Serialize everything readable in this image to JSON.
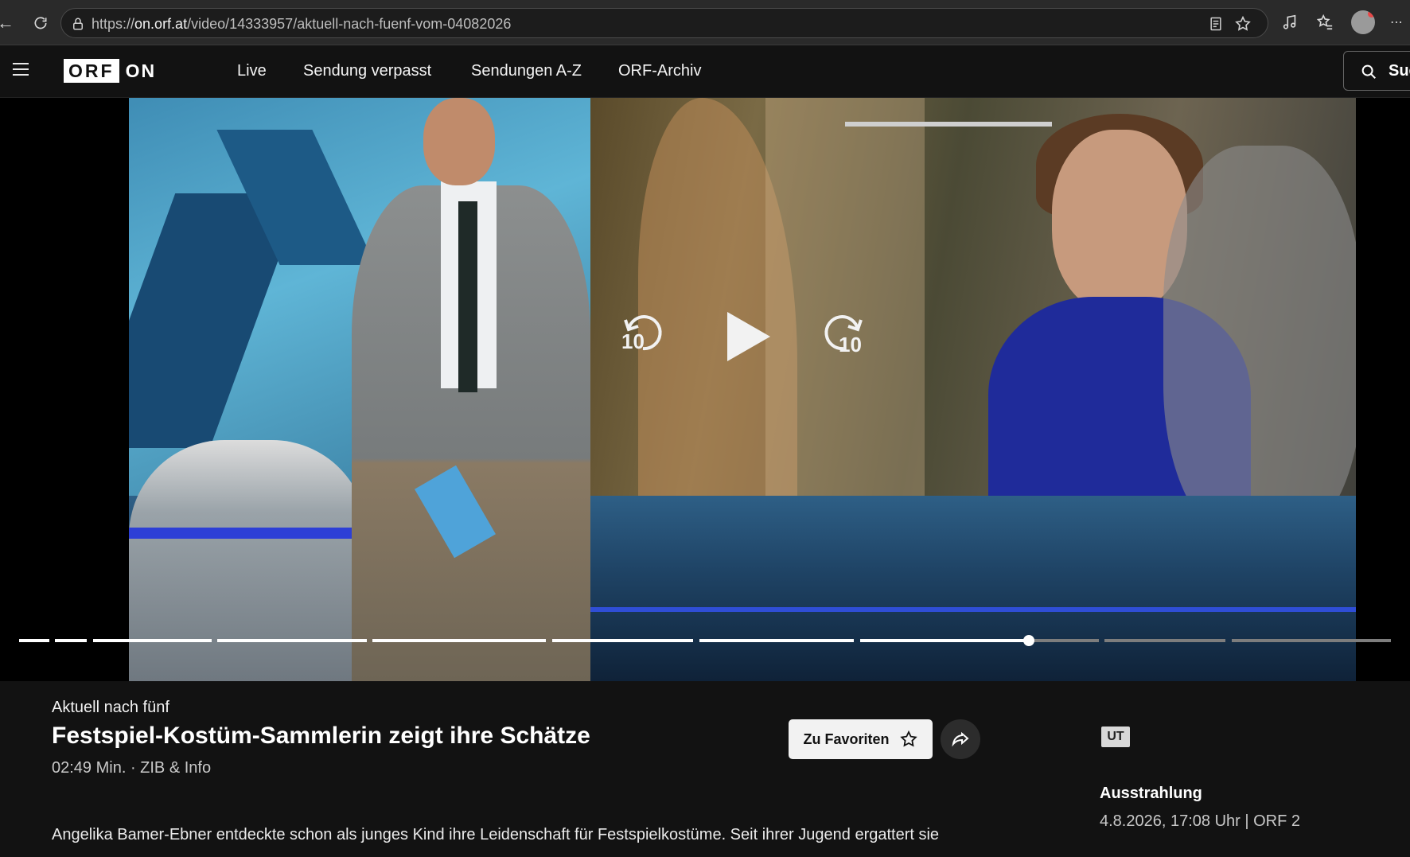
{
  "browser": {
    "url_prefix": "https://",
    "url_host": "on.orf.at",
    "url_path": "/video/14333957/aktuell-nach-fuenf-vom-04082026"
  },
  "header": {
    "logo_box": "ORF",
    "logo_suffix": "ON",
    "nav": [
      "Live",
      "Sendung verpasst",
      "Sendungen A-Z",
      "ORF-Archiv"
    ],
    "search_label": "Suc"
  },
  "player": {
    "back_seconds": "10",
    "forward_seconds": "10",
    "progress_fraction": 0.74
  },
  "info": {
    "show_name": "Aktuell nach fünf",
    "title": "Festspiel-Kostüm-Sammlerin zeigt ihre Schätze",
    "meta": "02:49 Min. · ZIB & Info",
    "favorite_label": "Zu Favoriten",
    "subtitle_badge": "UT",
    "airing_label": "Ausstrahlung",
    "airing_value": "4.8.2026, 17:08 Uhr | ORF 2",
    "description": "Angelika Bamer-Ebner entdeckte schon als junges Kind ihre Leidenschaft für Festspielkostüme. Seit ihrer Jugend ergattert sie"
  },
  "colors": {
    "background": "#121212",
    "button_light": "#f2f2f2",
    "progress_played": "#ffffff",
    "progress_rest": "#7d7d7d"
  }
}
